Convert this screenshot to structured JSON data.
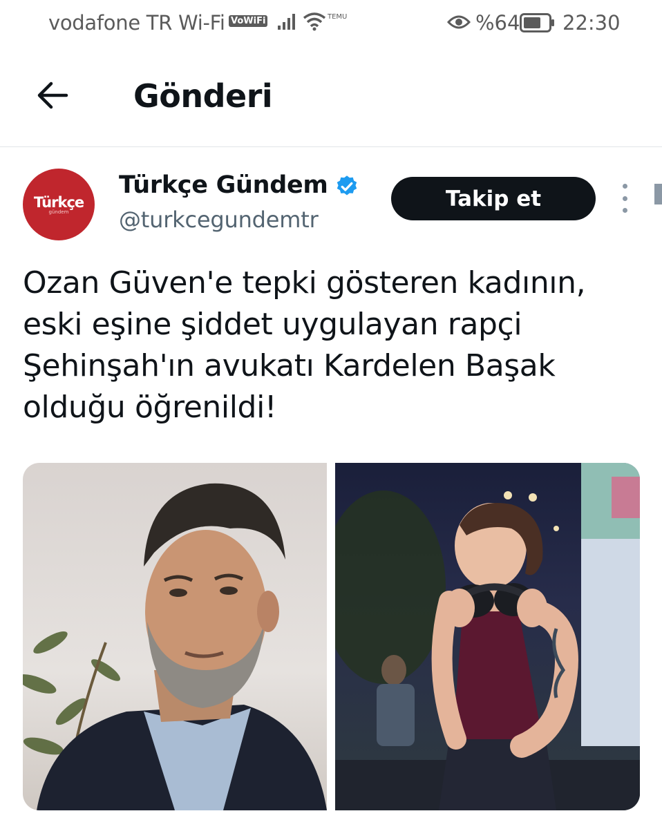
{
  "status_bar": {
    "carrier": "vodafone TR Wi-Fi",
    "vowifi_badge": "VoWiFi",
    "temu_label": "TEMU",
    "battery_percent": "%64",
    "time": "22:30"
  },
  "header": {
    "title": "Gönderi"
  },
  "tweet": {
    "author": {
      "avatar_text": "Türkçe",
      "avatar_sub": "gündem",
      "display_name": "Türkçe Gündem",
      "handle": "@turkcegundemtr",
      "verified": true
    },
    "follow_label": "Takip et",
    "text": "Ozan Güven'e tepki gösteren kadının,\neski eşine şiddet uygulayan rapçi\nŞehinşah'ın avukatı Kardelen Başak\nolduğu öğrenildi!",
    "media_count": 2
  },
  "colors": {
    "text_primary": "#0f1419",
    "text_secondary": "#536471",
    "verified_blue": "#1d9bf0",
    "avatar_red": "#c0262d",
    "follow_bg": "#0f1419"
  }
}
